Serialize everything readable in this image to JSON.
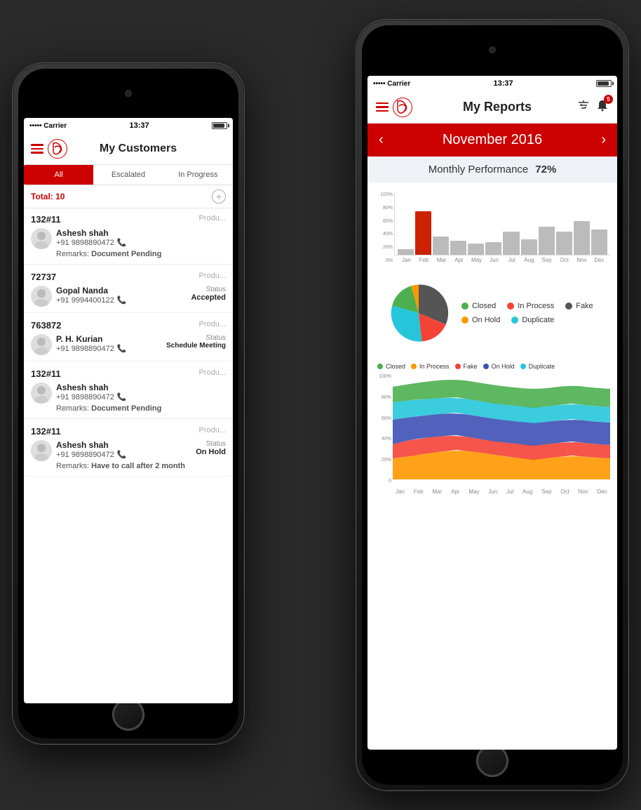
{
  "scene": {
    "bg": "#2a2a2a"
  },
  "phone1": {
    "status": {
      "carrier": "••••• Carrier",
      "time": "13:37",
      "signal": "●●●●●"
    },
    "header": {
      "title": "My Customers",
      "logo": "B"
    },
    "tabs": {
      "all": "All",
      "escalated": "Escalated",
      "inProgress": "In Progress"
    },
    "total": "Total: 10",
    "customers": [
      {
        "id": "132#11",
        "product": "Produ...",
        "name": "Ashesh shah",
        "phone": "+91 9898890472",
        "remarks": "Document Pending"
      },
      {
        "id": "72737",
        "product": "Produ...",
        "name": "Gopal Nanda",
        "phone": "+91 9994400122",
        "status_label": "Status",
        "status": "Accepted"
      },
      {
        "id": "763872",
        "product": "Produ...",
        "name": "P. H. Kurian",
        "phone": "+91 9898890472",
        "status_label": "Status",
        "status": "Schedule Meeting"
      },
      {
        "id": "132#11",
        "product": "Produ...",
        "name": "Ashesh shah",
        "phone": "+91 9898890472",
        "remarks": "Document Pending"
      },
      {
        "id": "132#11",
        "product": "Produ...",
        "name": "Ashesh shah",
        "phone": "+91 9898890472",
        "status_label": "Status",
        "status": "On Hold",
        "remarks": "Have to call after 2 month"
      }
    ]
  },
  "phone2": {
    "status": {
      "carrier": "••••• Carrier",
      "time": "13:37"
    },
    "header": {
      "title": "My Reports",
      "logo": "B"
    },
    "monthNav": {
      "prev": "‹",
      "title": "November  2016",
      "next": "›"
    },
    "performance": {
      "label": "Monthly Performance",
      "value": "72%"
    },
    "barChart": {
      "months": [
        "Jan",
        "Feb",
        "Mar",
        "Apr",
        "May",
        "Jun",
        "Jul",
        "Aug",
        "Sep",
        "Oct",
        "Nov",
        "Dec"
      ],
      "yLabels": [
        "100%",
        "80%",
        "60%",
        "40%",
        "20%",
        "0%"
      ],
      "febRedHeight": 65,
      "bars": [
        8,
        65,
        28,
        22,
        18,
        20,
        35,
        25,
        42,
        35,
        50,
        38
      ]
    },
    "pieChart": {
      "legend": [
        {
          "color": "#4caf50",
          "label": "Closed"
        },
        {
          "color": "#f44336",
          "label": "In Process"
        },
        {
          "color": "#555",
          "label": "Fake"
        },
        {
          "color": "#ff9800",
          "label": "On Hold"
        },
        {
          "color": "#26c6da",
          "label": "Duplicate"
        }
      ]
    },
    "areaChart": {
      "legend": [
        {
          "color": "#4caf50",
          "label": "Closed"
        },
        {
          "color": "#ff9800",
          "label": "In Process"
        },
        {
          "color": "#f44336",
          "label": "Fake"
        },
        {
          "color": "#3f51b5",
          "label": "On Hold"
        },
        {
          "color": "#26c6da",
          "label": "Duplicate"
        }
      ],
      "yLabels": [
        "100%",
        "80%",
        "60%",
        "40%",
        "20%",
        "0"
      ],
      "months": [
        "Jan",
        "Feb",
        "Mar",
        "Apr",
        "May",
        "Jun",
        "Jul",
        "Aug",
        "Sep",
        "Oct",
        "Nov",
        "Dec"
      ]
    }
  }
}
